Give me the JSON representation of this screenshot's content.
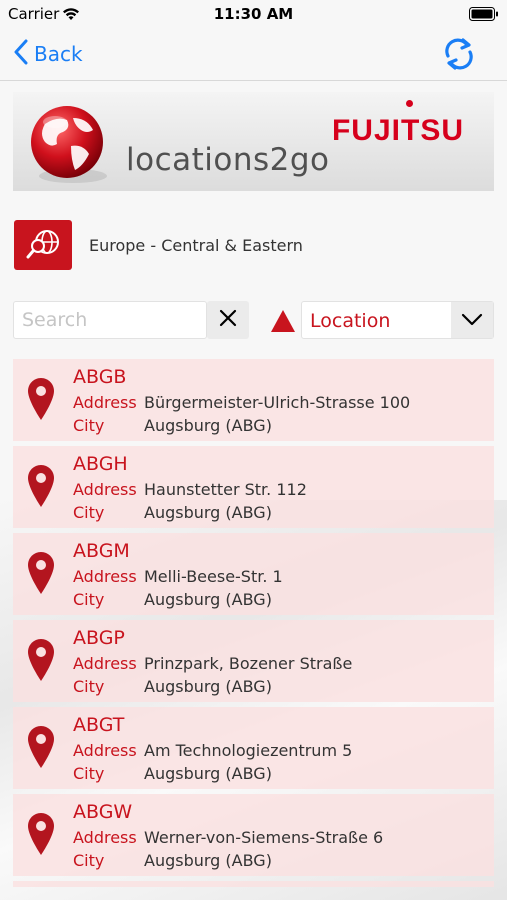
{
  "status_bar": {
    "carrier": "Carrier",
    "time": "11:30 AM"
  },
  "nav": {
    "back_label": "Back",
    "refresh_icon": "refresh-icon"
  },
  "banner": {
    "title": "locations2go",
    "brand": "FUJITSU"
  },
  "region": {
    "label": "Europe - Central & Eastern"
  },
  "search": {
    "placeholder": "Search",
    "value": ""
  },
  "sort": {
    "selected": "Location"
  },
  "colors": {
    "accent": "#c8141e",
    "link": "#1a7ef5",
    "row_bg": "#fae1e1"
  },
  "labels": {
    "address": "Address",
    "city": "City"
  },
  "locations": [
    {
      "code": "ABGB",
      "address": "Bürgermeister-Ulrich-Strasse 100",
      "city": "Augsburg (ABG)"
    },
    {
      "code": "ABGH",
      "address": "Haunstetter Str. 112",
      "city": "Augsburg (ABG)"
    },
    {
      "code": "ABGM",
      "address": "Melli-Beese-Str. 1",
      "city": "Augsburg (ABG)"
    },
    {
      "code": "ABGP",
      "address": "Prinzpark, Bozener Straße",
      "city": "Augsburg (ABG)"
    },
    {
      "code": "ABGT",
      "address": "Am Technologiezentrum 5",
      "city": "Augsburg (ABG)"
    },
    {
      "code": "ABGW",
      "address": "Werner-von-Siemens-Straße 6",
      "city": "Augsburg (ABG)"
    }
  ]
}
